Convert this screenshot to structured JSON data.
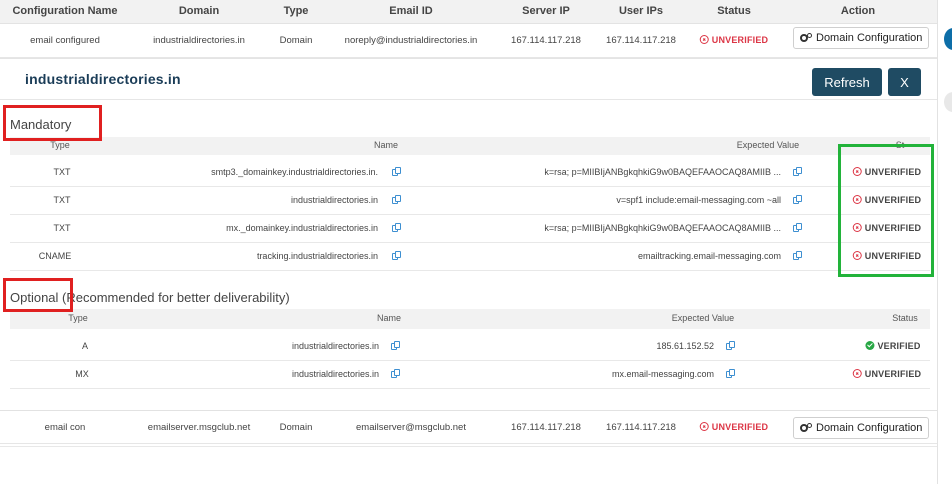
{
  "main_table": {
    "headers": [
      "Configuration Name",
      "Domain",
      "Type",
      "Email ID",
      "Server IP",
      "User IPs",
      "Status",
      "Action"
    ],
    "rows": [
      {
        "config_name": "email configured",
        "domain": "industrialdirectories.in",
        "type": "Domain",
        "email_id": "noreply@industrialdirectories.in",
        "server_ip": "167.114.117.218",
        "user_ips": "167.114.117.218",
        "status": "UNVERIFIED",
        "action": "Domain Configuration"
      },
      {
        "config_name": "email con",
        "domain": "emailserver.msgclub.net",
        "type": "Domain",
        "email_id": "emailserver@msgclub.net",
        "server_ip": "167.114.117.218",
        "user_ips": "167.114.117.218",
        "status": "UNVERIFIED",
        "action": "Domain Configuration"
      }
    ]
  },
  "panel": {
    "domain_title": "industrialdirectories.in",
    "refresh_label": "Refresh",
    "close_label": "X",
    "mandatory": {
      "title": "Mandatory",
      "headers": [
        "Type",
        "Name",
        "Expected Value",
        "St"
      ],
      "rows": [
        {
          "type": "TXT",
          "name": "smtp3._domainkey.industrialdirectories.in.",
          "value": "k=rsa; p=MIIBIjANBgkqhkiG9w0BAQEFAAOCAQ8AMIIB ...",
          "status": "UNVERIFIED"
        },
        {
          "type": "TXT",
          "name": "industrialdirectories.in",
          "value": "v=spf1 include:email-messaging.com ~all",
          "status": "UNVERIFIED"
        },
        {
          "type": "TXT",
          "name": "mx._domainkey.industrialdirectories.in",
          "value": "k=rsa; p=MIIBIjANBgkqhkiG9w0BAQEFAAOCAQ8AMIIB ...",
          "status": "UNVERIFIED"
        },
        {
          "type": "CNAME",
          "name": "tracking.industrialdirectories.in",
          "value": "emailtracking.email-messaging.com",
          "status": "UNVERIFIED"
        }
      ]
    },
    "optional": {
      "title": "Optional",
      "subtitle": "(Recommended for better deliverability)",
      "headers": [
        "Type",
        "Name",
        "Expected Value",
        "Status"
      ],
      "rows": [
        {
          "type": "A",
          "name": "industrialdirectories.in",
          "value": "185.61.152.52",
          "status": "VERIFIED"
        },
        {
          "type": "MX",
          "name": "industrialdirectories.in",
          "value": "mx.email-messaging.com",
          "status": "UNVERIFIED"
        }
      ]
    }
  },
  "colors": {
    "brand_button": "#1f4b63",
    "unverified": "#dc3545",
    "verified": "#28a745",
    "highlight_red": "#e02020",
    "highlight_green": "#22b33a"
  }
}
